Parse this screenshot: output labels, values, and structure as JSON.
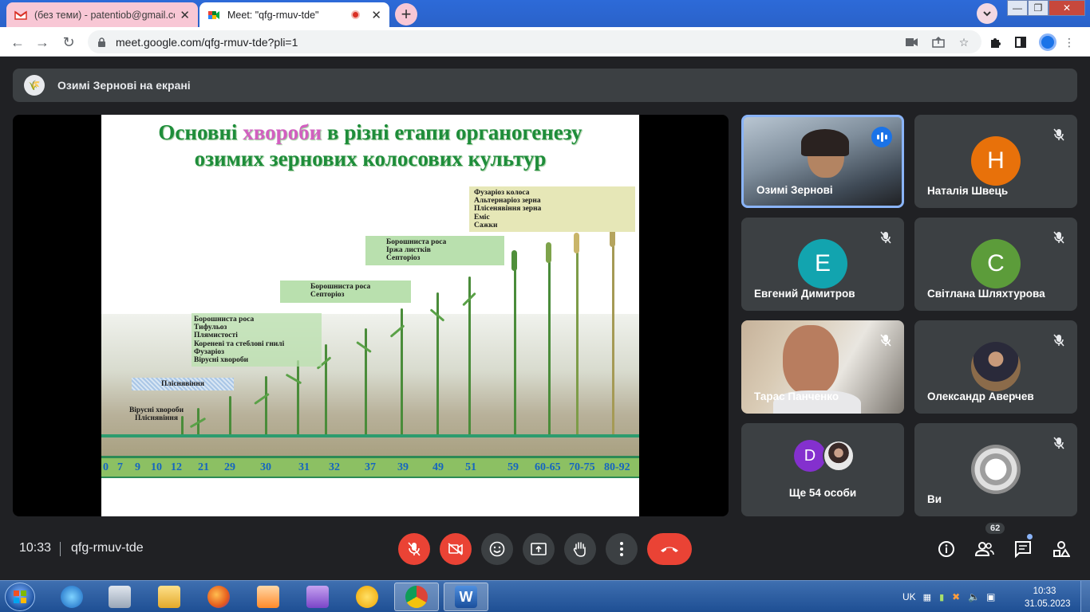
{
  "browser": {
    "tabs": [
      {
        "title": "(без теми) - patentiob@gmail.co",
        "close": "✕",
        "active": false
      },
      {
        "title": "Meet: \"qfg-rmuv-tde\"",
        "close": "✕",
        "active": true
      }
    ],
    "new_tab": "+",
    "url": "meet.google.com/qfg-rmuv-tde?pli=1"
  },
  "meet": {
    "presenting_label": "Озимі Зернові на екрані",
    "slide": {
      "title_part1": "Основні ",
      "title_highlight": "хвороби",
      "title_part2": " в різні етапи органогенезу",
      "title_line2": "озимих зернових колосових культур",
      "notes": [
        {
          "lines": [
            "Фузаріоз колоса",
            "Альтернаріоз зерна",
            "Плісенявіння зерна",
            "Еміс",
            "Сажки"
          ]
        },
        {
          "lines": [
            "Борошниста роса",
            "Іржа листків",
            "Септоріоз"
          ]
        },
        {
          "lines": [
            "Борошниста роса",
            "Септоріоз"
          ]
        },
        {
          "lines": [
            "Борошниста роса",
            "Тифульоз",
            "Плямистості",
            "Кореневі та стеблові гнилі",
            "Фузаріоз",
            "Вірусні хвороби"
          ]
        },
        {
          "lines": [
            "Пліснявіння"
          ]
        },
        {
          "lines": [
            "Вірусні хвороби",
            "Пліснявіння"
          ]
        }
      ],
      "stages": [
        "0",
        "7",
        "9",
        "10",
        "12",
        "21",
        "29",
        "30",
        "31",
        "32",
        "37",
        "39",
        "49",
        "51",
        "59",
        "60-65",
        "70-75",
        "80-92"
      ]
    },
    "participants": [
      {
        "name": "Озимі Зернові",
        "type": "video",
        "speaking": true
      },
      {
        "name": "Наталія Швець",
        "initial": "Н",
        "color": "#e8710a",
        "muted": true
      },
      {
        "name": "Евгений Димитров",
        "initial": "Е",
        "color": "#12a4af",
        "muted": true
      },
      {
        "name": "Світлана Шляхтурова",
        "initial": "С",
        "color": "#5c9c3a",
        "muted": true
      },
      {
        "name": "Тарас Панченко",
        "type": "video",
        "muted": true
      },
      {
        "name": "Олександр Аверчев",
        "type": "photo",
        "muted": true
      },
      {
        "name": "Ще 54 особи",
        "initial": "D",
        "color": "#8430ce"
      },
      {
        "name": "Ви",
        "muted": true
      }
    ],
    "bottom": {
      "time": "10:33",
      "meeting_code": "qfg-rmuv-tde",
      "participant_count": "62"
    }
  },
  "taskbar": {
    "lang": "UK",
    "time": "10:33",
    "date": "31.05.2023"
  },
  "colors": {
    "meet_bg": "#202124",
    "tile_bg": "#3c4043",
    "red": "#ea4335",
    "title_green": "#1e8d3a",
    "highlight_pink": "#d25fc0"
  }
}
